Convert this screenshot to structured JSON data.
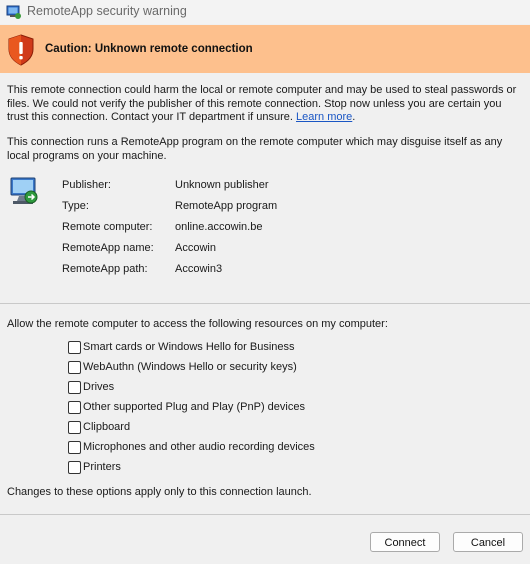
{
  "window": {
    "title": "RemoteApp security warning",
    "icon": "remote-app-icon"
  },
  "banner": {
    "heading": "Caution: Unknown remote connection",
    "icon": "warning-shield-icon",
    "color": "#fdc08d"
  },
  "warning": {
    "text": "This remote connection could harm the local or remote computer and may be used to steal passwords or files. We could not verify the publisher of this remote connection. Stop now unless you are certain you trust this connection. Contact your IT department if unsure.",
    "link": "Learn more",
    "link_suffix": "."
  },
  "notice": "This connection runs a RemoteApp program on the remote computer which may disguise itself as any local programs on your machine.",
  "details": [
    {
      "label": "Publisher:",
      "value": "Unknown publisher"
    },
    {
      "label": "Type:",
      "value": "RemoteApp program"
    },
    {
      "label": "Remote computer:",
      "value": "online.accowin.be"
    },
    {
      "label": "RemoteApp name:",
      "value": "Accowin"
    },
    {
      "label": "RemoteApp path:",
      "value": "Accowin3"
    }
  ],
  "resources": {
    "prompt": "Allow the remote computer to access the following resources on my computer:",
    "items": [
      {
        "label": "Smart cards or Windows Hello for Business",
        "checked": false
      },
      {
        "label": "WebAuthn (Windows Hello or security keys)",
        "checked": false
      },
      {
        "label": "Drives",
        "checked": false
      },
      {
        "label": "Other supported Plug and Play (PnP) devices",
        "checked": false
      },
      {
        "label": "Clipboard",
        "checked": false
      },
      {
        "label": "Microphones and other audio recording devices",
        "checked": false
      },
      {
        "label": "Printers",
        "checked": false
      }
    ],
    "note": "Changes to these options apply only to this connection launch."
  },
  "buttons": {
    "connect": "Connect",
    "cancel": "Cancel"
  }
}
